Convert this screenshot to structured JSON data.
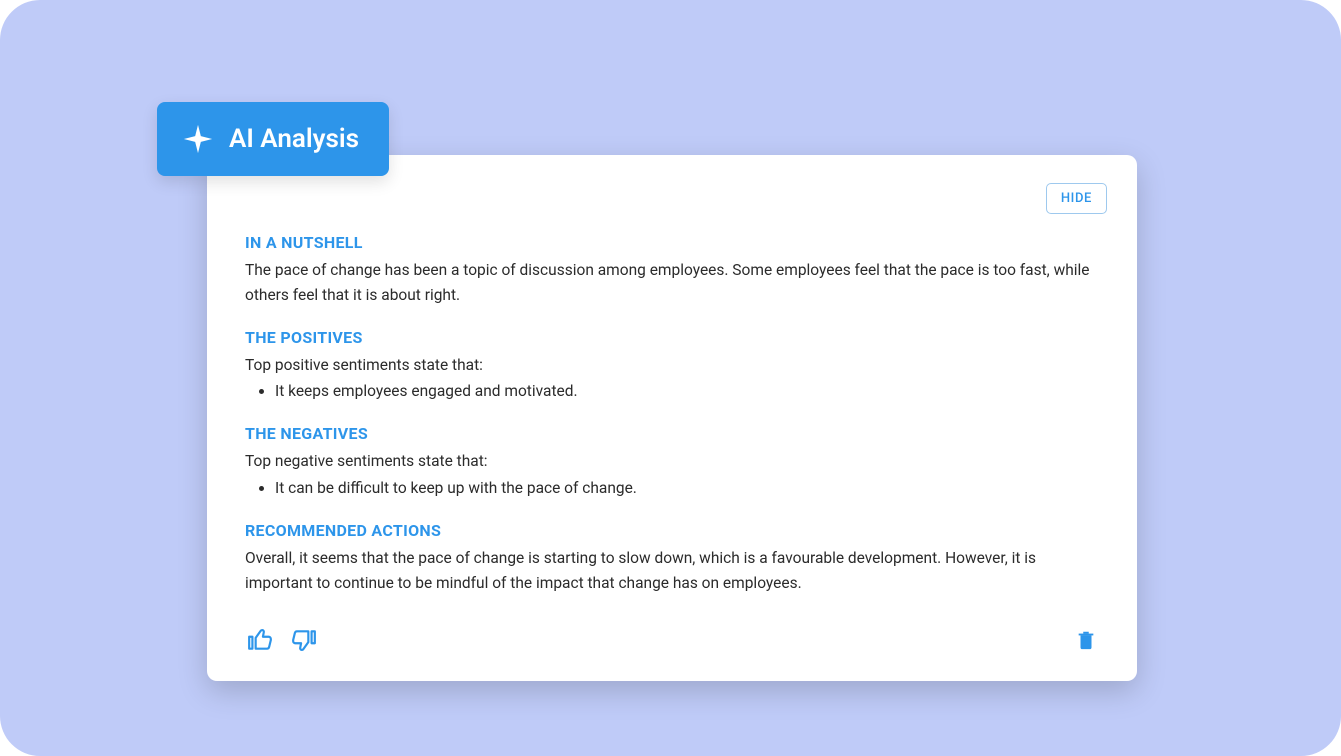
{
  "badge": {
    "label": "AI Analysis"
  },
  "hide_button": "HIDE",
  "sections": {
    "nutshell": {
      "heading": "IN A NUTSHELL",
      "body": "The pace of change has been a topic of discussion among employees. Some employees feel that the pace is too fast, while others feel that it is about right."
    },
    "positives": {
      "heading": "THE POSITIVES",
      "intro": "Top positive sentiments state that:",
      "bullets": [
        "It keeps employees engaged and motivated."
      ]
    },
    "negatives": {
      "heading": "THE NEGATIVES",
      "intro": "Top negative sentiments state that:",
      "bullets": [
        "It can be difficult to keep up with the pace of change."
      ]
    },
    "recommended": {
      "heading": "RECOMMENDED ACTIONS",
      "body": "Overall, it seems that the pace of change is starting to slow down, which is a favourable development. However, it is important to continue to be mindful of the impact that change has on employees."
    }
  },
  "icons": {
    "sparkle": "sparkle-icon",
    "thumbs_up": "thumbs-up-icon",
    "thumbs_down": "thumbs-down-icon",
    "trash": "trash-icon"
  },
  "colors": {
    "background": "#bfcbf8",
    "accent": "#2d95ea",
    "text": "#2b2b2b"
  }
}
